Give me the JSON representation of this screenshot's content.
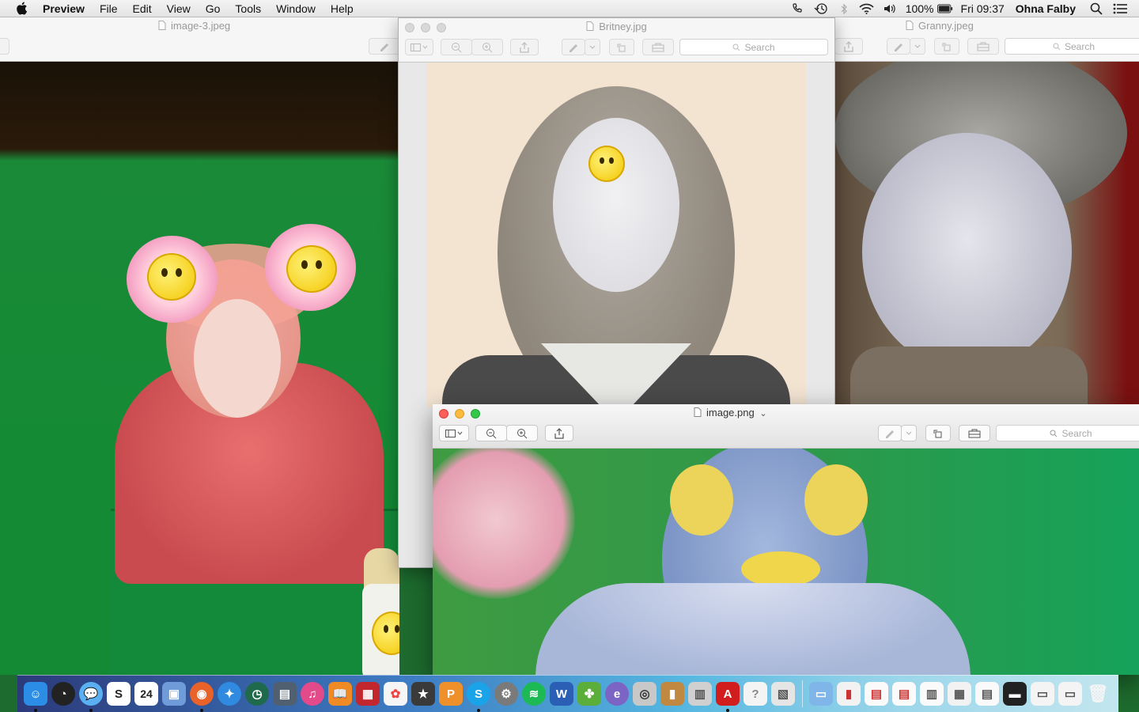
{
  "menubar": {
    "app_name": "Preview",
    "items": [
      "File",
      "Edit",
      "View",
      "Go",
      "Tools",
      "Window",
      "Help"
    ],
    "battery": "100%",
    "clock": "Fri 09:37",
    "user": "Ohna Falby",
    "status_icons": [
      "phone-icon",
      "time-machine-icon",
      "bluetooth-icon",
      "wifi-icon",
      "volume-icon",
      "battery-icon",
      "spotlight-icon",
      "notification-center-icon"
    ]
  },
  "windows": {
    "image3": {
      "title": "image-3.jpeg"
    },
    "britney": {
      "title": "Britney.jpg",
      "search_placeholder": "Search"
    },
    "granny": {
      "title": "Granny.jpeg",
      "search_placeholder": "Search"
    },
    "imagepng": {
      "title": "image.png",
      "title_suffix": "⌄",
      "search_placeholder": "Search"
    }
  },
  "dock": {
    "calendar_day": "24",
    "apps": [
      "Finder",
      "Dashboard",
      "Messages",
      "Slack",
      "Calendar",
      "Preview",
      "Firefox",
      "Safari",
      "Time Machine",
      "Scanner",
      "iTunes",
      "iBooks",
      "Photo Booth",
      "Photos",
      "iMovie Star",
      "Pages",
      "Skype",
      "System Preferences",
      "Spotify",
      "Word",
      "Plants vs Zombies",
      "Edge",
      "Camera",
      "Notes",
      "Mission Control",
      "Acrobat",
      "Help",
      "Image Capture"
    ],
    "colors": {
      "finder": "#2b8de6",
      "dashboard": "#222222",
      "messages": "#5ab0f0",
      "slack": "#ffffff",
      "calendar": "#ffffff",
      "preview": "#6f9cd8",
      "firefox": "#e8622a",
      "safari": "#2f8ae0",
      "timemachine": "#1f6a4c",
      "scanner": "#506070",
      "itunes": "#e24a8a",
      "ibooks": "#f08a24",
      "photobooth": "#c2272d",
      "photos": "#f5f5f5",
      "star": "#3a3a3a",
      "pages": "#f0902a",
      "skype": "#1aa3e8",
      "sysprefs": "#7a7a7a",
      "spotify": "#1db954",
      "word": "#2b5fb6",
      "pvz": "#5cae3a",
      "edge": "#7b64c4",
      "camera": "#c8c8c8",
      "notes": "#c08840",
      "mission": "#d0d0d0",
      "acrobat": "#d11d1d",
      "help": "#f4f4f4",
      "capture": "#e5e5e5"
    }
  }
}
